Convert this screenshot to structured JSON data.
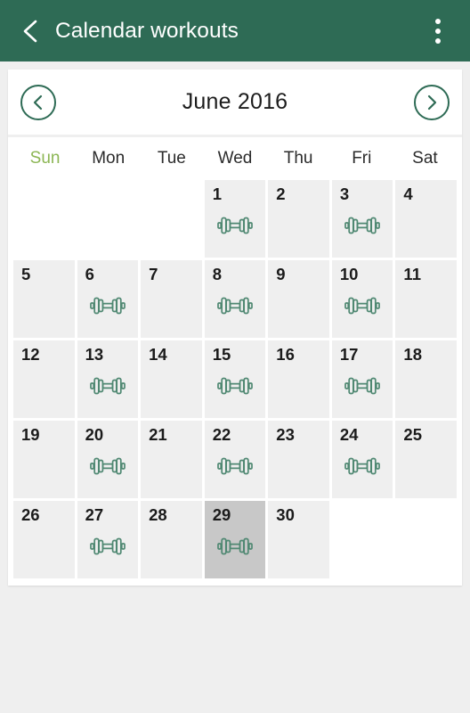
{
  "appbar": {
    "title": "Calendar workouts",
    "back_icon": "chevron-left-icon",
    "overflow_icon": "more-vertical-icon",
    "background_color": "#2e6b55",
    "text_color": "#ffffff"
  },
  "month_nav": {
    "prev_icon": "chevron-left-circle-icon",
    "next_icon": "chevron-right-circle-icon",
    "label": "June 2016",
    "accent_color": "#2e6b55"
  },
  "weekdays": [
    {
      "label": "Sun",
      "highlight": true,
      "color": "#8cb654"
    },
    {
      "label": "Mon",
      "highlight": false,
      "color": "#2b2b2b"
    },
    {
      "label": "Tue",
      "highlight": false,
      "color": "#2b2b2b"
    },
    {
      "label": "Wed",
      "highlight": false,
      "color": "#2b2b2b"
    },
    {
      "label": "Thu",
      "highlight": false,
      "color": "#2b2b2b"
    },
    {
      "label": "Fri",
      "highlight": false,
      "color": "#2b2b2b"
    },
    {
      "label": "Sat",
      "highlight": false,
      "color": "#2b2b2b"
    }
  ],
  "calendar": {
    "month": "June",
    "year": "2016",
    "first_day_column": 3,
    "days_in_month": 30,
    "selected_day": 29,
    "workout_icon": "dumbbell-icon",
    "cell_color": "#efefef",
    "selected_cell_color": "#c8c8c8",
    "workout_icon_color": "#4f8872",
    "days": [
      {
        "num": "1",
        "workout": true
      },
      {
        "num": "2",
        "workout": false
      },
      {
        "num": "3",
        "workout": true
      },
      {
        "num": "4",
        "workout": false
      },
      {
        "num": "5",
        "workout": false
      },
      {
        "num": "6",
        "workout": true
      },
      {
        "num": "7",
        "workout": false
      },
      {
        "num": "8",
        "workout": true
      },
      {
        "num": "9",
        "workout": false
      },
      {
        "num": "10",
        "workout": true
      },
      {
        "num": "11",
        "workout": false
      },
      {
        "num": "12",
        "workout": false
      },
      {
        "num": "13",
        "workout": true
      },
      {
        "num": "14",
        "workout": false
      },
      {
        "num": "15",
        "workout": true
      },
      {
        "num": "16",
        "workout": false
      },
      {
        "num": "17",
        "workout": true
      },
      {
        "num": "18",
        "workout": false
      },
      {
        "num": "19",
        "workout": false
      },
      {
        "num": "20",
        "workout": true
      },
      {
        "num": "21",
        "workout": false
      },
      {
        "num": "22",
        "workout": true
      },
      {
        "num": "23",
        "workout": false
      },
      {
        "num": "24",
        "workout": true
      },
      {
        "num": "25",
        "workout": false
      },
      {
        "num": "26",
        "workout": false
      },
      {
        "num": "27",
        "workout": true
      },
      {
        "num": "28",
        "workout": false
      },
      {
        "num": "29",
        "workout": true
      },
      {
        "num": "30",
        "workout": false
      }
    ]
  }
}
